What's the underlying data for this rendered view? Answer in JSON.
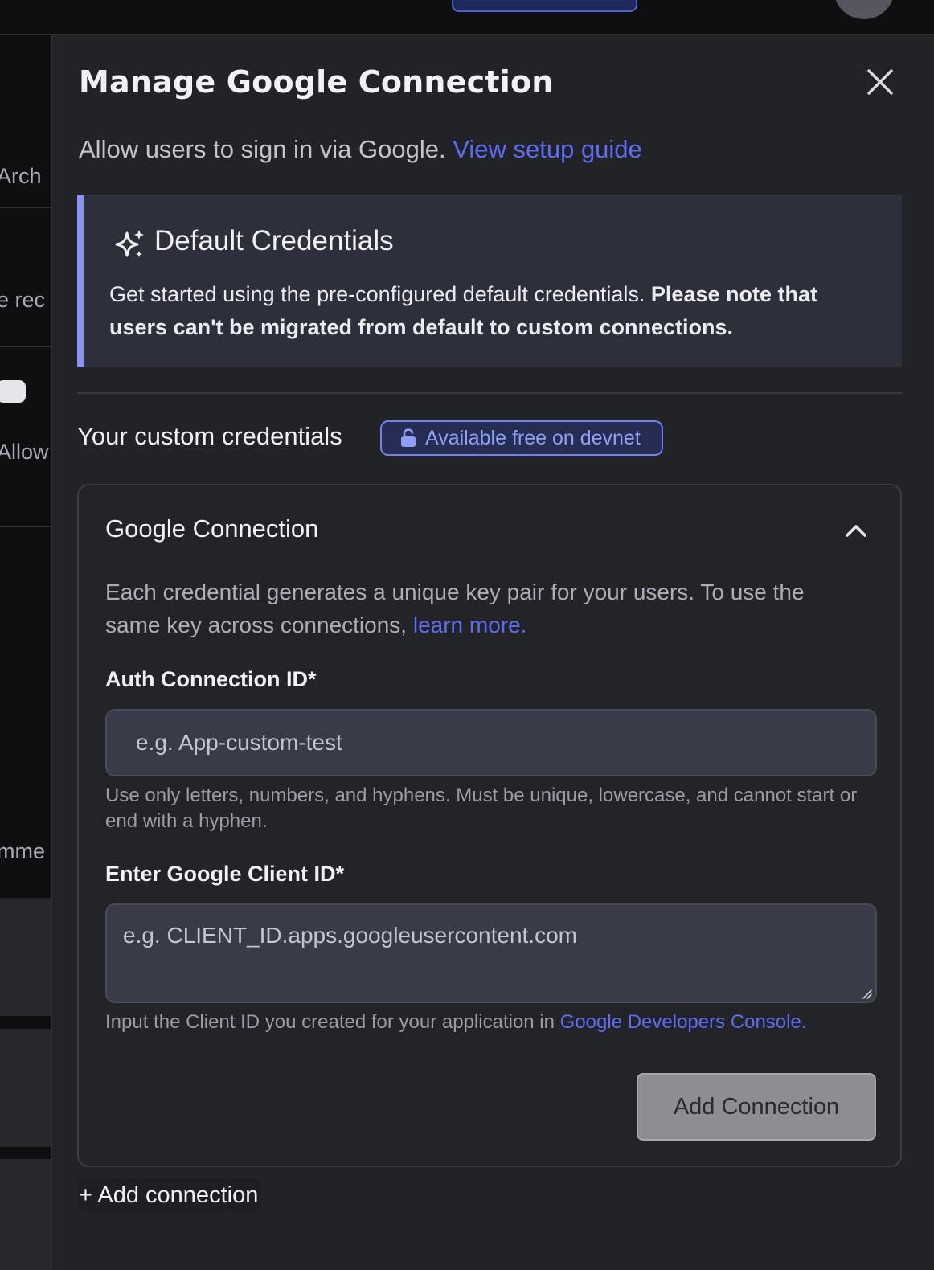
{
  "background": {
    "fragments": [
      "Arch",
      "e rec",
      "Allow",
      "mme"
    ]
  },
  "drawer": {
    "title": "Manage Google Connection",
    "subtitle": "Allow users to sign in via Google.",
    "setup_link": "View setup guide",
    "default_credentials": {
      "heading": "Default Credentials",
      "body": "Get started using the pre-configured default credentials.",
      "note": "Please note that users can't be migrated from default to custom connections."
    },
    "custom": {
      "title": "Your custom credentials",
      "badge": "Available free on devnet"
    },
    "connection_card": {
      "title": "Google Connection",
      "description": "Each credential generates a unique key pair for your users. To use the same key across connections,",
      "learn_more": "learn more.",
      "auth_id": {
        "label": "Auth Connection ID*",
        "placeholder": "e.g. App-custom-test",
        "help": "Use only letters, numbers, and hyphens. Must be unique, lowercase, and cannot start or end with a hyphen."
      },
      "client_id": {
        "label": "Enter Google Client ID*",
        "placeholder": "e.g. CLIENT_ID.apps.googleusercontent.com",
        "help": "Input the Client ID you created for your application in",
        "help_link": "Google Developers Console."
      },
      "submit_label": "Add Connection"
    },
    "add_connection_link": "+ Add connection"
  },
  "colors": {
    "accent_link": "#5d6cf2",
    "badge": "#6f82ef",
    "callout_border": "#8794f3"
  }
}
